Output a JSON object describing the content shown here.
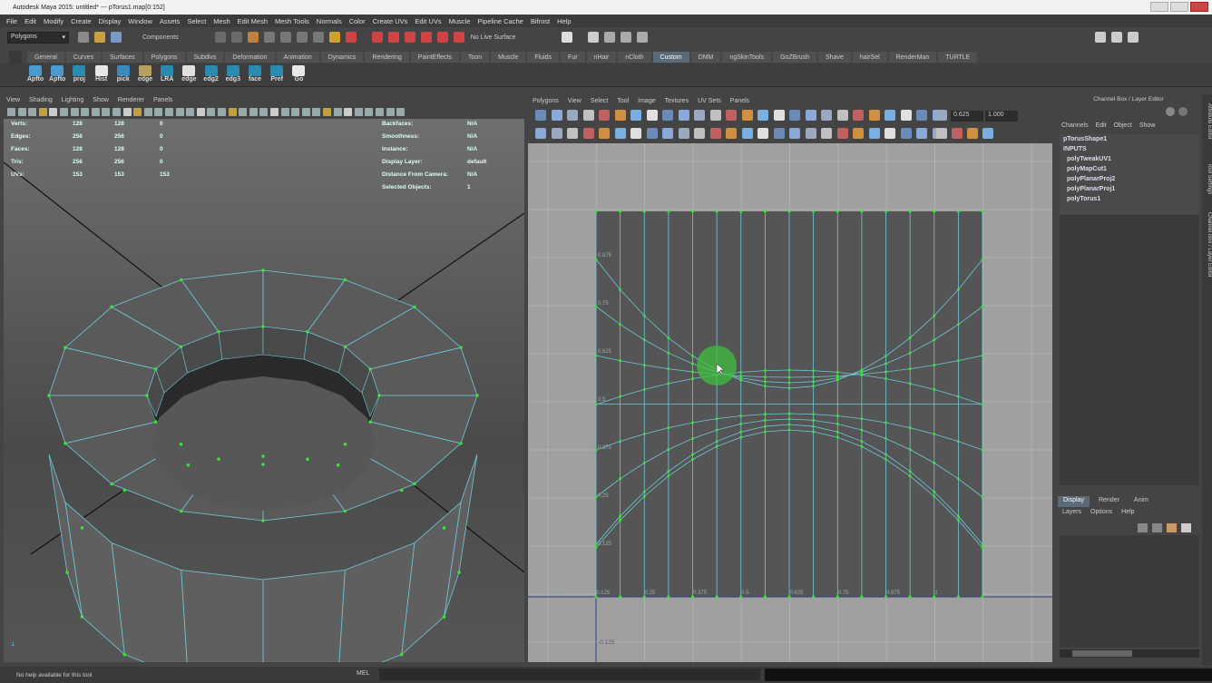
{
  "titlebar": {
    "title": "Autodesk Maya 2015: untitled*   ---   pTorus1.map[0:152]"
  },
  "menubar": [
    "File",
    "Edit",
    "Modify",
    "Create",
    "Display",
    "Window",
    "Assets",
    "Select",
    "Mesh",
    "Edit Mesh",
    "Mesh Tools",
    "Normals",
    "Color",
    "Create UVs",
    "Edit UVs",
    "Muscle",
    "Pipeline Cache",
    "Bifrost",
    "Help"
  ],
  "statusline": {
    "mode": "Polygons",
    "select_mode": "Components",
    "live_surface": "No Live Surface"
  },
  "shelf": {
    "tabs": [
      "General",
      "Curves",
      "Surfaces",
      "Polygons",
      "Subdivs",
      "Deformation",
      "Animation",
      "Dynamics",
      "Rendering",
      "PaintEffects",
      "Toon",
      "Muscle",
      "Fluids",
      "Fur",
      "nHair",
      "nCloth",
      "Custom",
      "DMM",
      "ngSkinTools",
      "GoZBrush",
      "Shave",
      "hairSel",
      "RenderMan",
      "TURTLE"
    ],
    "active_tab": "Custom",
    "buttons": [
      "Apfto",
      "Apfto",
      "proj",
      "Hist",
      "pick",
      "edge",
      "LRA",
      "edge",
      "edg2",
      "edg3",
      "face",
      "Pref",
      "Go"
    ]
  },
  "viewport": {
    "menu": [
      "View",
      "Shading",
      "Lighting",
      "Show",
      "Renderer",
      "Panels"
    ],
    "hud_left": [
      {
        "label": "Verts:",
        "v1": "128",
        "v2": "128",
        "v3": "0"
      },
      {
        "label": "Edges:",
        "v1": "256",
        "v2": "256",
        "v3": "0"
      },
      {
        "label": "Faces:",
        "v1": "128",
        "v2": "128",
        "v3": "0"
      },
      {
        "label": "Tris:",
        "v1": "256",
        "v2": "256",
        "v3": "0"
      },
      {
        "label": "UVs:",
        "v1": "153",
        "v2": "153",
        "v3": "153"
      }
    ],
    "hud_right": [
      {
        "label": "Backfaces:",
        "value": "N/A"
      },
      {
        "label": "Smoothness:",
        "value": "N/A"
      },
      {
        "label": "Instance:",
        "value": "N/A"
      },
      {
        "label": "Display Layer:",
        "value": "default"
      },
      {
        "label": "Distance From Camera:",
        "value": "N/A"
      },
      {
        "label": "Selected Objects:",
        "value": "1"
      }
    ]
  },
  "uv_editor": {
    "menu": [
      "Polygons",
      "View",
      "Select",
      "Tool",
      "Image",
      "Textures",
      "UV Sets",
      "Panels"
    ],
    "field_a": "0.625",
    "field_b": "1.000",
    "tick_labels_v": [
      "0.875",
      "0.75",
      "0.625",
      "0.5",
      "0.375",
      "0.25",
      "0.125"
    ],
    "tick_labels_u": [
      "-0.125",
      "0.125",
      "0.25",
      "0.375",
      "0.5",
      "0.625",
      "0.75",
      "0.875",
      "1"
    ],
    "bottom_label": "-0.125",
    "accent": "#6ec8d8",
    "vertex_color": "#3ce03c"
  },
  "channel_box": {
    "title": "Channel Box / Layer Editor",
    "menu": [
      "Channels",
      "Edit",
      "Object",
      "Show"
    ],
    "shape": "pTorusShape1",
    "inputs_label": "INPUTS",
    "inputs": [
      "polyTweakUV1",
      "polyMapCut1",
      "polyPlanarProj2",
      "polyPlanarProj1",
      "polyTorus1"
    ]
  },
  "layer_editor": {
    "tabs": [
      "Display",
      "Render",
      "Anim"
    ],
    "active_tab": "Display",
    "menu": [
      "Layers",
      "Options",
      "Help"
    ]
  },
  "side_tabs": [
    "Attribute Editor",
    "Tool Settings",
    "Channel Box / Layer Editor"
  ],
  "helpline": {
    "text": "No help available for this tool",
    "mel_label": "MEL"
  }
}
